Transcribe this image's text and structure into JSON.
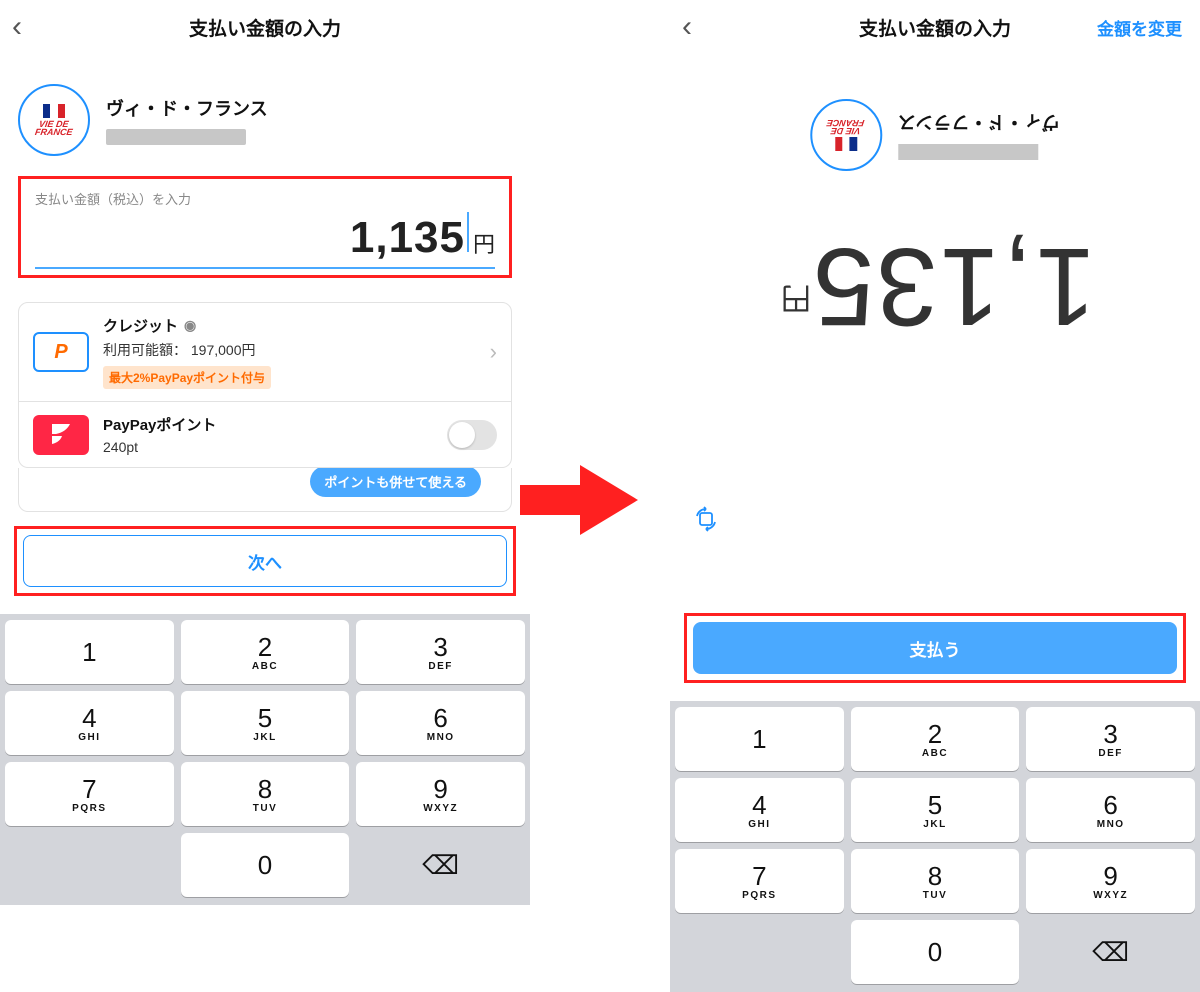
{
  "left": {
    "header_title": "支払い金額の入力",
    "merchant_name": "ヴィ・ド・フランス",
    "logo_top": "VIE DE",
    "logo_bottom": "FRANCE",
    "amount_label": "支払い金額（税込）を入力",
    "amount_value": "1,135",
    "amount_unit": "円",
    "pm_credit_title": "クレジット",
    "pm_credit_limit_label": "利用可能額：",
    "pm_credit_limit_value": "197,000円",
    "pm_credit_badge": "最大2%PayPayポイント付与",
    "pm_points_title": "PayPayポイント",
    "pm_points_value": "240pt",
    "tooltip_text": "ポイントも併せて使える",
    "next_label": "次へ"
  },
  "right": {
    "header_title": "支払い金額の入力",
    "header_action": "金額を変更",
    "amount_value": "1,135",
    "amount_unit": "円",
    "merchant_name": "ヴィ・ド・フランス",
    "logo_top": "VIE DE",
    "logo_bottom": "FRANCE",
    "pay_label": "支払う"
  },
  "keypad": [
    {
      "n": "1",
      "s": ""
    },
    {
      "n": "2",
      "s": "ABC"
    },
    {
      "n": "3",
      "s": "DEF"
    },
    {
      "n": "4",
      "s": "GHI"
    },
    {
      "n": "5",
      "s": "JKL"
    },
    {
      "n": "6",
      "s": "MNO"
    },
    {
      "n": "7",
      "s": "PQRS"
    },
    {
      "n": "8",
      "s": "TUV"
    },
    {
      "n": "9",
      "s": "WXYZ"
    },
    {
      "n": "",
      "s": ""
    },
    {
      "n": "0",
      "s": ""
    },
    {
      "n": "⌫",
      "s": ""
    }
  ]
}
